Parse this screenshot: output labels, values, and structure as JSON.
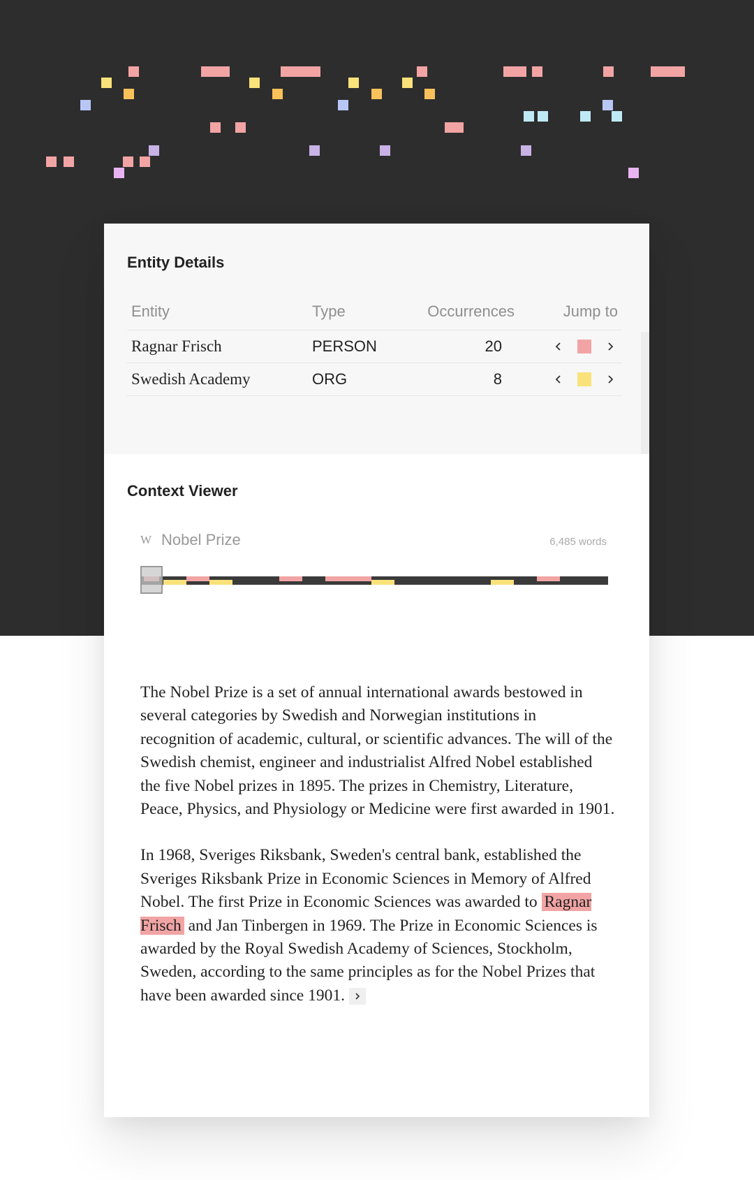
{
  "colors": {
    "person": "#f2a4a4",
    "org": "#fae27a",
    "blue": "#b7c6f5",
    "orange": "#f8c15a",
    "cyan": "#bfeaf5",
    "lavender": "#c8b2e6",
    "pink": "#e9b4f2"
  },
  "entity_details": {
    "title": "Entity Details",
    "columns": [
      "Entity",
      "Type",
      "Occurrences",
      "Jump to"
    ],
    "rows": [
      {
        "entity": "Ragnar Frisch",
        "type": "PERSON",
        "occurrences": "20",
        "color": "#f2a4a4"
      },
      {
        "entity": "Swedish Academy",
        "type": "ORG",
        "occurrences": "8",
        "color": "#fae27a"
      }
    ],
    "prev_icon": "chevron-left-icon",
    "next_icon": "chevron-right-icon"
  },
  "context_viewer": {
    "title": "Context Viewer",
    "doc_icon": "wikipedia-icon",
    "doc_icon_glyph": "W",
    "doc_title": "Nobel Prize",
    "word_count": "6,485 words",
    "paragraph1": "The Nobel Prize is a set of annual international awards bestowed in several categories by Swedish and Norwegian institutions in recognition of academic, cultural, or scientific advances. The will of the Swedish chemist, engineer and industrialist Alfred Nobel established the five Nobel prizes in 1895. The prizes in Chemistry, Literature, Peace, Physics, and Physiology or Medicine were first awarded in 1901.",
    "paragraph2_before": "In 1968, Sveriges Riksbank, Sweden's central bank, established the Sveriges Riksbank Prize in Economic Sciences in Memory of Alfred Nobel. The first Prize in Economic Sciences was awarded to ",
    "paragraph2_highlight": "Ragnar Frisch",
    "paragraph2_after": " and Jan Tinbergen in 1969. The Prize in Economic Sciences is awarded by the Royal Swedish Academy of Sciences, Stockholm, Sweden, according to the same principles as for the Nobel Prizes that have been awarded since 1901.",
    "more_icon": "chevron-right-icon"
  }
}
